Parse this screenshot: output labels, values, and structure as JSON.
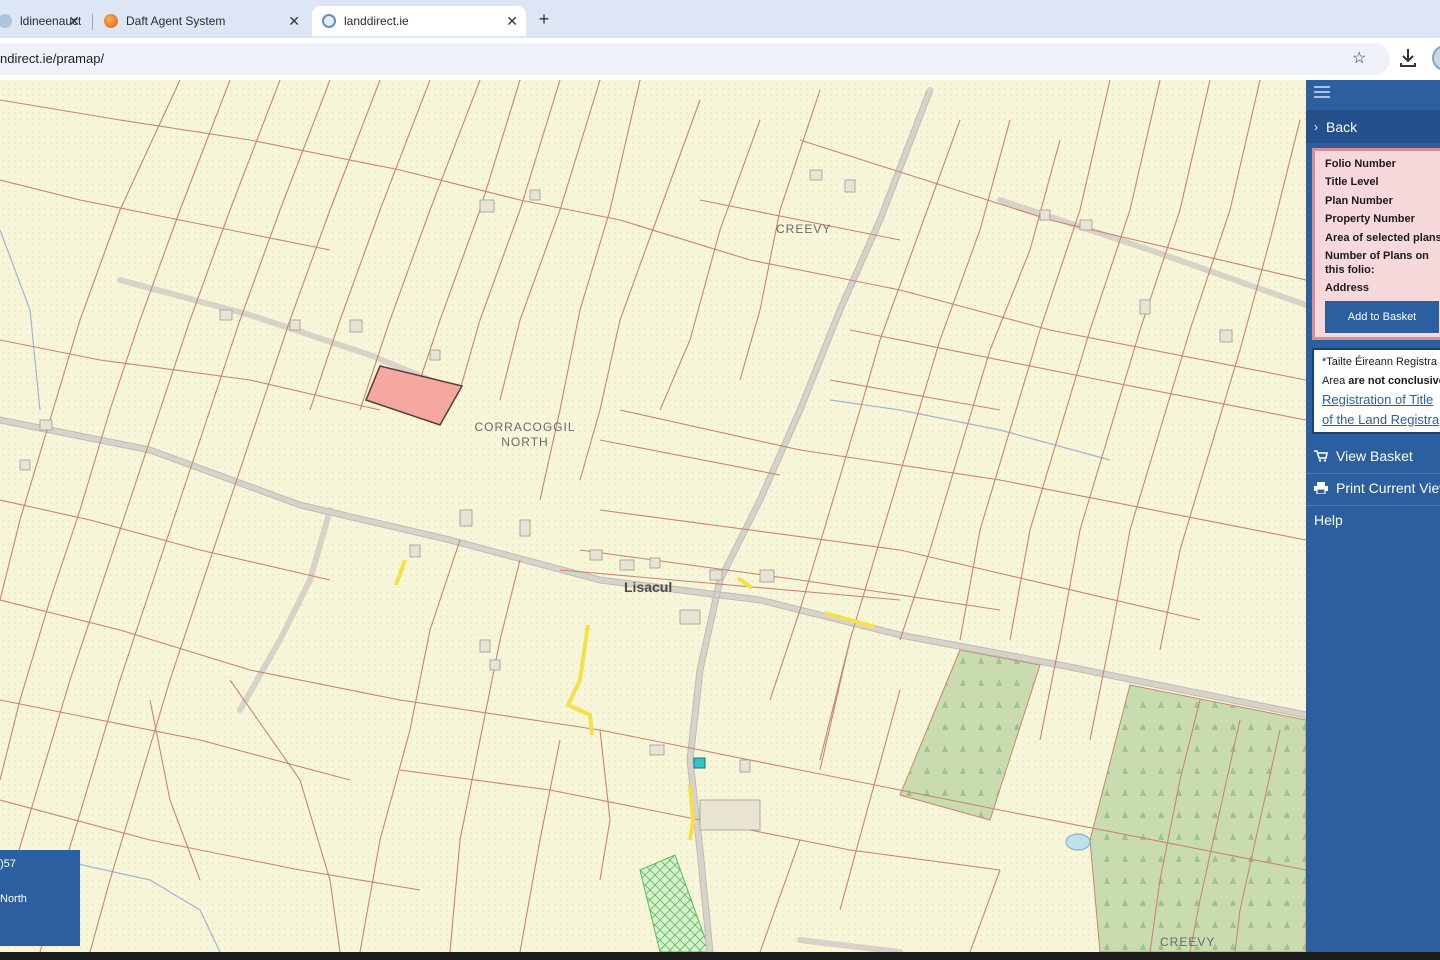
{
  "browser": {
    "tabs": [
      {
        "title": "ldineenauct",
        "favicon": "globe-icon"
      },
      {
        "title": "Daft Agent System",
        "favicon": "daft-logo-icon"
      },
      {
        "title": "landdirect.ie",
        "favicon": "landdirect-logo-icon",
        "active": true
      }
    ],
    "url": "ndirect.ie/pramap/"
  },
  "map": {
    "labels": {
      "creevy_top": "CREEVY",
      "corracoggil": "CORRACOGGIL\nNORTH",
      "lisacul": "Lisacul",
      "creevy_bottom": "CREEVY"
    },
    "overlay": {
      "line1": ")57",
      "line2": "North"
    },
    "colors": {
      "background": "#f7f6d9",
      "boundary": "#c98570",
      "selected": "#f4a8a0",
      "forest": "#c9dcb0",
      "highlight": "#f4e04a"
    }
  },
  "sidebar": {
    "back_label": "Back",
    "fields": {
      "folio": "Folio Number",
      "title_level": "Title Level",
      "plan_number": "Plan Number",
      "property_number": "Property Number",
      "area": "Area of selected plans",
      "num_plans_1": "Number of Plans on",
      "num_plans_2": "this folio:",
      "address": "Address"
    },
    "add_basket": "Add to Basket",
    "notice": {
      "line1": "*Tailte Éireann Registra",
      "line2a": "Area ",
      "line2b": "are not conclusive",
      "link1": "Registration of Title",
      "link2": "of the Land Registra"
    },
    "view_basket": "View Basket",
    "print_view": "Print Current View",
    "help": "Help",
    "colors": {
      "bg": "#2c5fa0",
      "panel": "#f7d9dc"
    }
  }
}
